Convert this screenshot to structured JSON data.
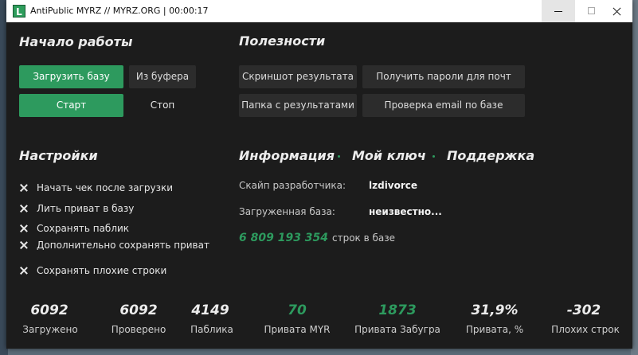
{
  "window": {
    "title": "AntiPublic MYRZ // MYRZ.ORG | 00:00:17",
    "icon_letter": "L"
  },
  "start_section": {
    "heading": "Начало работы",
    "load_db": "Загрузить базу",
    "from_clipboard": "Из буфера",
    "start": "Старт",
    "stop": "Стоп"
  },
  "utilities": {
    "heading": "Полезности",
    "screenshot": "Скриншот результата",
    "get_passwords": "Получить пароли для почт",
    "results_folder": "Папка с результатами",
    "check_email": "Проверка email по базе"
  },
  "settings": {
    "heading": "Настройки",
    "options": [
      "Начать чек после загрузки",
      "Лить приват в базу",
      "Сохранять паблик",
      "Дополнительно сохранять приват",
      "Сохранять плохие строки"
    ]
  },
  "info": {
    "tab_info": "Информация",
    "tab_key": "Мой ключ",
    "tab_support": "Поддержка",
    "dev_skype_label": "Скайп разработчика:",
    "dev_skype_value": "lzdivorce",
    "loaded_db_label": "Загруженная база:",
    "loaded_db_value": "неизвестно...",
    "lines_count": "6 809 193 354",
    "lines_label": "строк в базе"
  },
  "stats": [
    {
      "value": "6092",
      "label": "Загружено",
      "accent": false
    },
    {
      "value": "6092",
      "label": "Проверено",
      "accent": false
    },
    {
      "value": "4149",
      "label": "Паблика",
      "accent": false
    },
    {
      "value": "70",
      "label": "Привата MYR",
      "accent": true
    },
    {
      "value": "1873",
      "label": "Привата Забугра",
      "accent": true
    },
    {
      "value": "31,9%",
      "label": "Привата, %",
      "accent": false
    },
    {
      "value": "-302",
      "label": "Плохих строк",
      "accent": false
    }
  ],
  "colors": {
    "accent": "#2d9a5e",
    "background": "#1c1c1c",
    "button": "#2c2c2c"
  }
}
